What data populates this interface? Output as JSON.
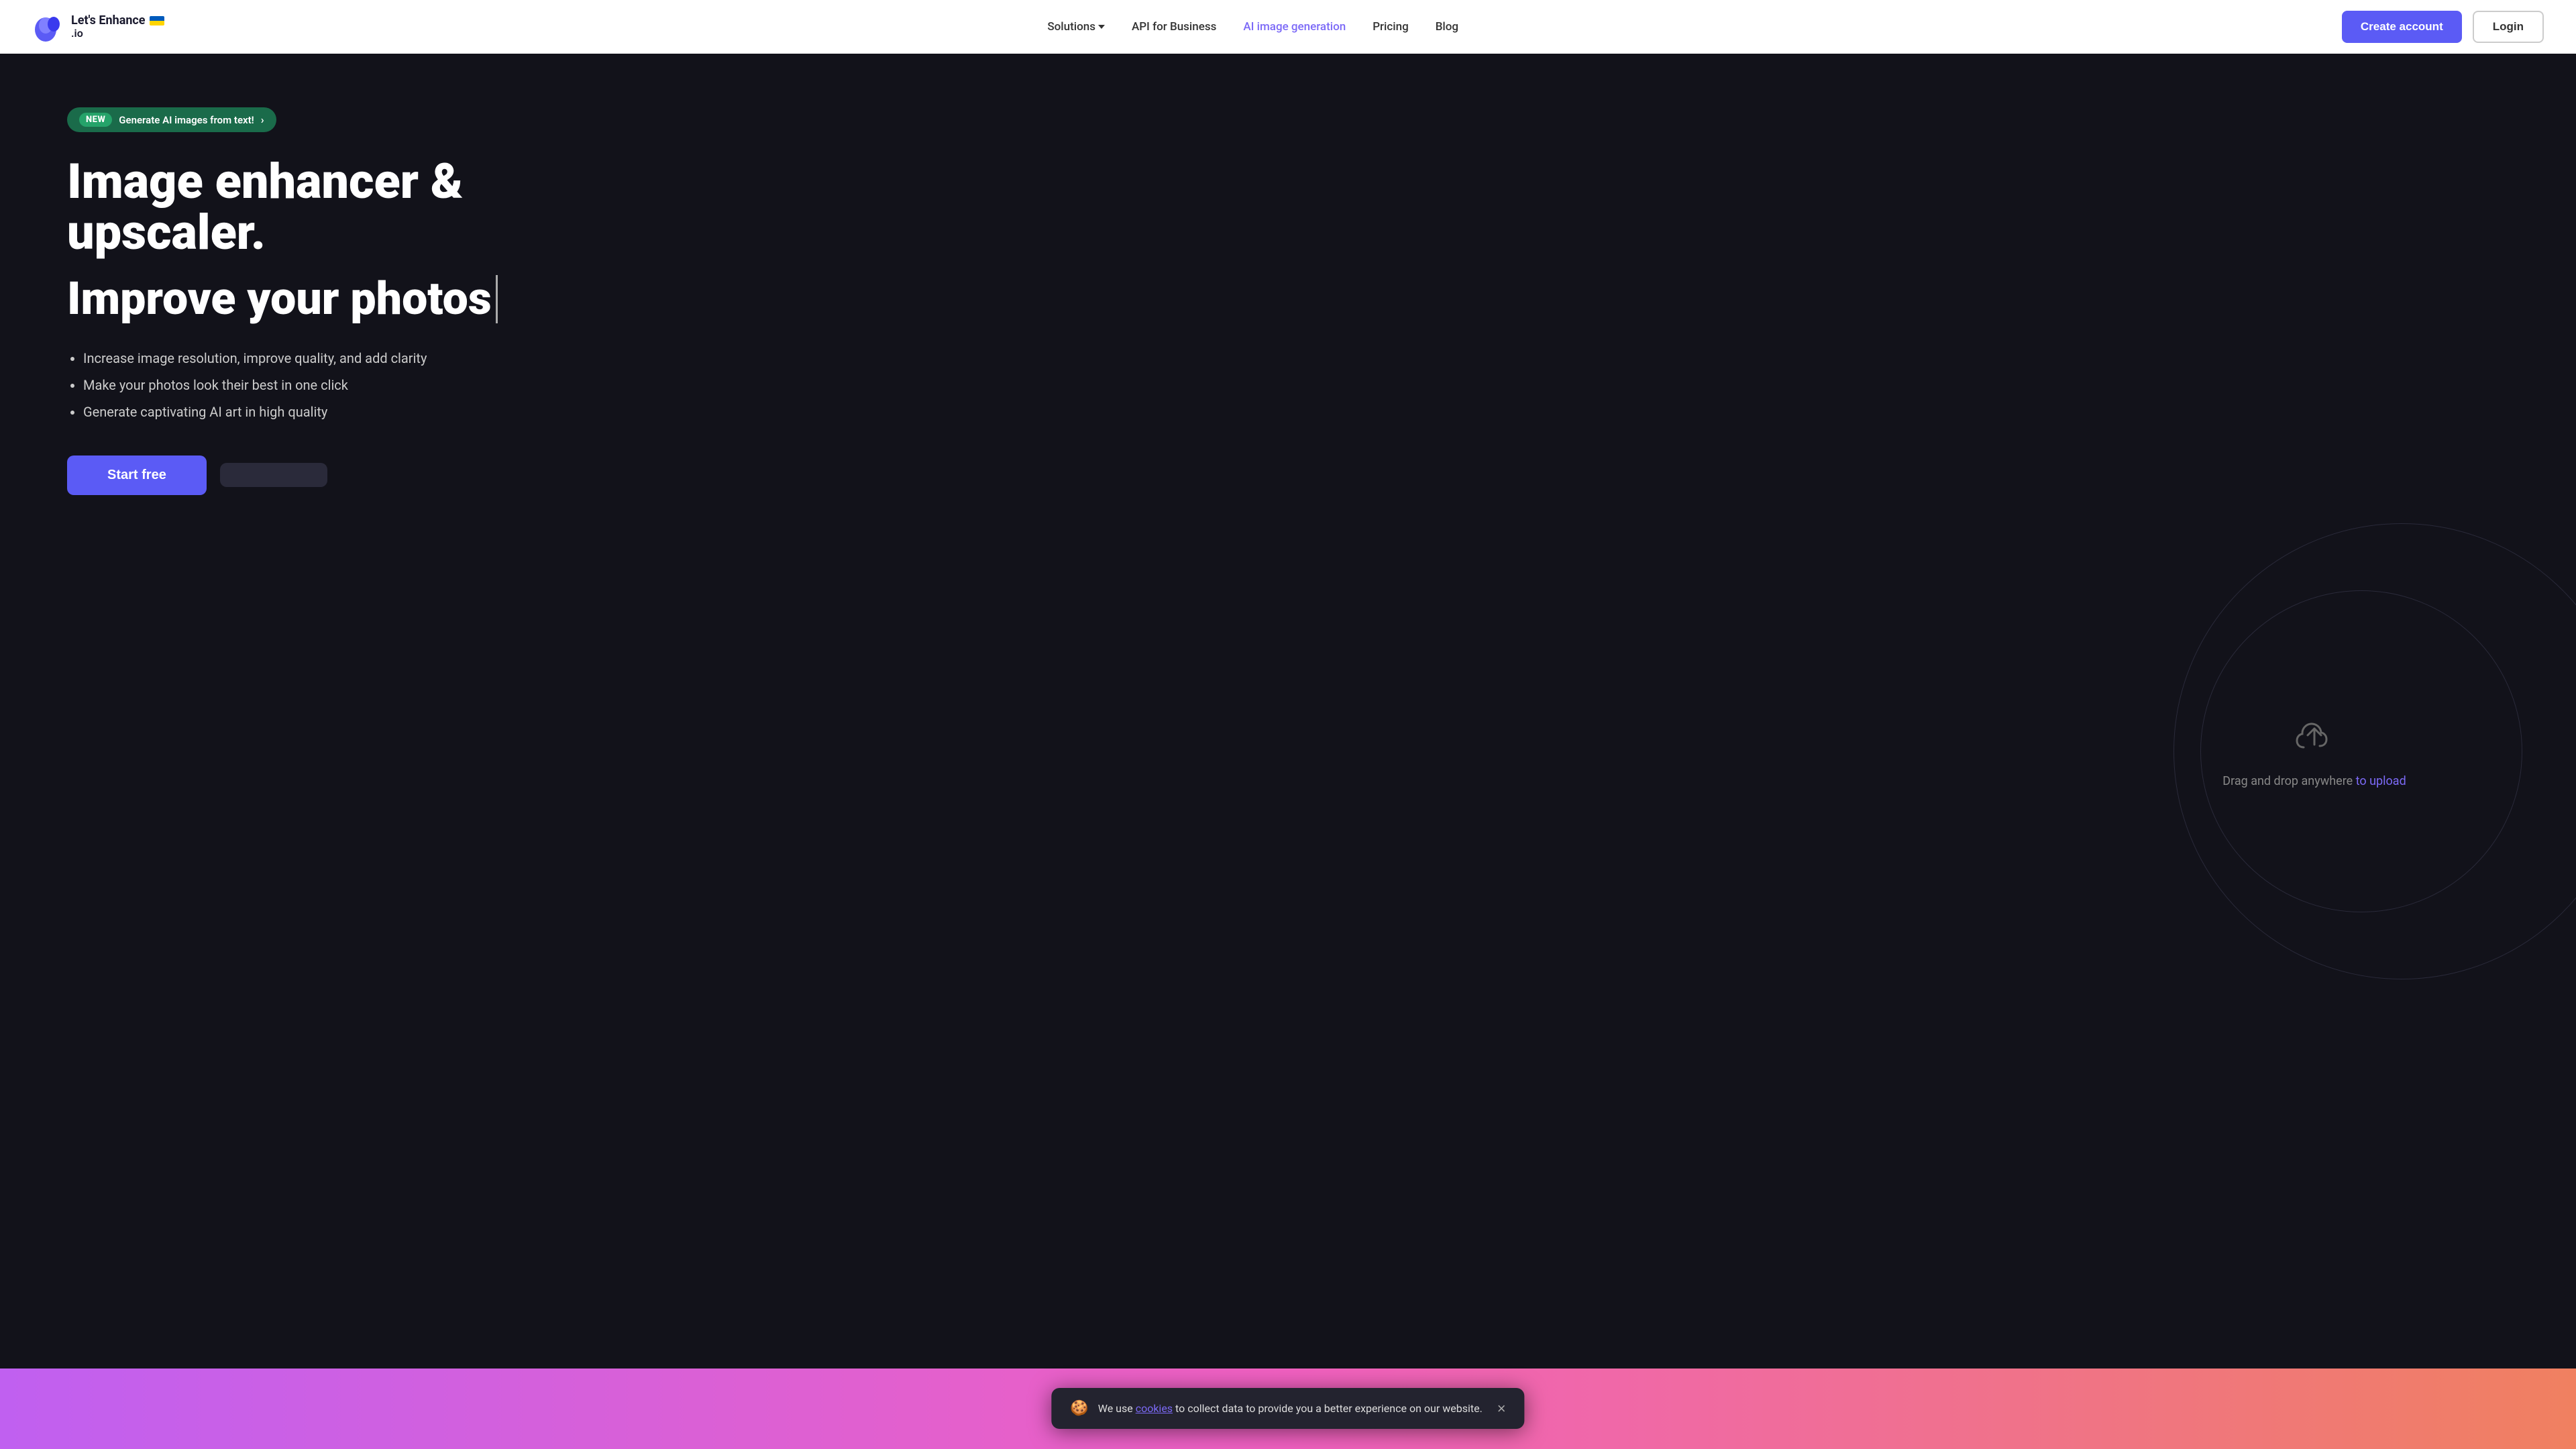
{
  "nav": {
    "logo_text_top": "Let's Enhance",
    "logo_text_bottom": ".io",
    "links": [
      {
        "label": "Solutions",
        "has_dropdown": true,
        "active": false
      },
      {
        "label": "API for Business",
        "has_dropdown": false,
        "active": false
      },
      {
        "label": "AI image generation",
        "has_dropdown": false,
        "active": true
      },
      {
        "label": "Pricing",
        "has_dropdown": false,
        "active": false
      },
      {
        "label": "Blog",
        "has_dropdown": false,
        "active": false
      }
    ],
    "create_account": "Create account",
    "login": "Login"
  },
  "hero": {
    "badge_new": "NEW",
    "badge_text": "Generate AI images from text!",
    "title": "Image enhancer & upscaler.",
    "subtitle": "Improve your photos",
    "bullets": [
      "Increase image resolution, improve quality, and add clarity",
      "Make your photos look their best in one click",
      "Generate captivating AI art in high quality"
    ],
    "start_free": "Start free",
    "secondary_btn": "",
    "upload_text_before": "Drag and drop anywhere ",
    "upload_link": "to upload"
  },
  "cookie": {
    "text_before": "We use ",
    "link_text": "cookies",
    "text_after": " to collect data to provide you a better experience on our website.",
    "close_label": "×"
  },
  "colors": {
    "accent": "#5b5bf5",
    "accent_nav": "#7c6af7",
    "badge_bg": "#1a6b4a",
    "badge_inner_bg": "#25a36a"
  }
}
